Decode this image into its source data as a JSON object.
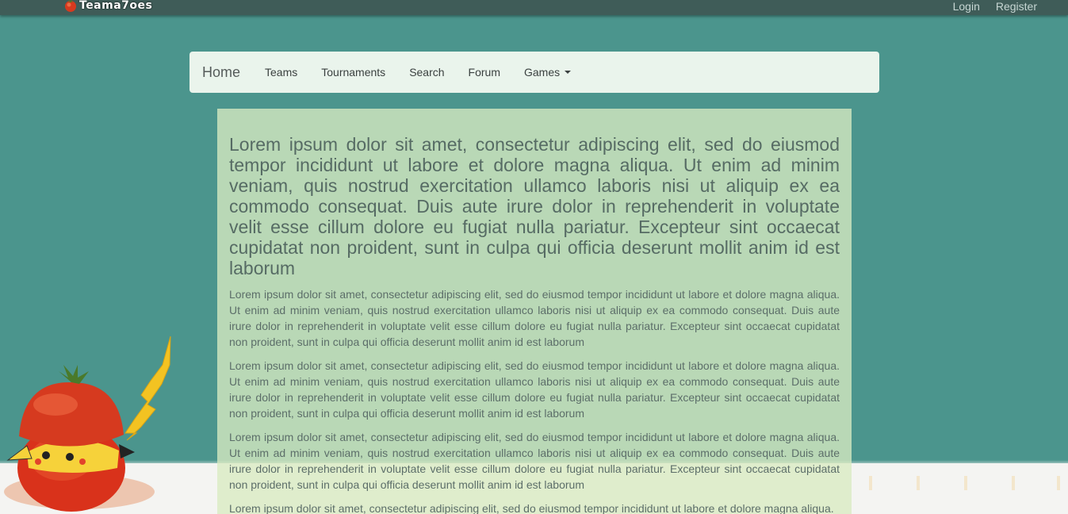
{
  "brand": {
    "name": "Teama7oes"
  },
  "top_links": {
    "login": "Login",
    "register": "Register"
  },
  "navbar": {
    "home": "Home",
    "items": [
      "Teams",
      "Tournaments",
      "Search",
      "Forum"
    ],
    "games": "Games"
  },
  "content": {
    "lead": "Lorem ipsum dolor sit amet, consectetur adipiscing elit, sed do eiusmod tempor incididunt ut labore et dolore magna aliqua. Ut enim ad minim veniam, quis nostrud exercitation ullamco laboris nisi ut aliquip ex ea commodo consequat. Duis aute irure dolor in reprehenderit in voluptate velit esse cillum dolore eu fugiat nulla pariatur. Excepteur sint occaecat cupidatat non proident, sunt in culpa qui officia deserunt mollit anim id est laborum",
    "paragraphs": [
      "Lorem ipsum dolor sit amet, consectetur adipiscing elit, sed do eiusmod tempor incididunt ut labore et dolore magna aliqua. Ut enim ad minim veniam, quis nostrud exercitation ullamco laboris nisi ut aliquip ex ea commodo consequat. Duis aute irure dolor in reprehenderit in voluptate velit esse cillum dolore eu fugiat nulla pariatur. Excepteur sint occaecat cupidatat non proident, sunt in culpa qui officia deserunt mollit anim id est laborum",
      "Lorem ipsum dolor sit amet, consectetur adipiscing elit, sed do eiusmod tempor incididunt ut labore et dolore magna aliqua. Ut enim ad minim veniam, quis nostrud exercitation ullamco laboris nisi ut aliquip ex ea commodo consequat. Duis aute irure dolor in reprehenderit in voluptate velit esse cillum dolore eu fugiat nulla pariatur. Excepteur sint occaecat cupidatat non proident, sunt in culpa qui officia deserunt mollit anim id est laborum",
      "Lorem ipsum dolor sit amet, consectetur adipiscing elit, sed do eiusmod tempor incididunt ut labore et dolore magna aliqua. Ut enim ad minim veniam, quis nostrud exercitation ullamco laboris nisi ut aliquip ex ea commodo consequat. Duis aute irure dolor in reprehenderit in voluptate velit esse cillum dolore eu fugiat nulla pariatur. Excepteur sint occaecat cupidatat non proident, sunt in culpa qui officia deserunt mollit anim id est laborum",
      "Lorem ipsum dolor sit amet, consectetur adipiscing elit, sed do eiusmod tempor incididunt ut labore et dolore magna aliqua."
    ]
  },
  "icons": {
    "brand_logo": "tomato-icon",
    "games_caret": "caret-down-icon",
    "mascot": "tomato-pikachu-illustration"
  },
  "colors": {
    "background": "#4b958d",
    "topbar": "#3f5c58",
    "navbar": "#eaf4ec",
    "content_panel": "#d9eac2",
    "floor": "#f4f4f2"
  }
}
